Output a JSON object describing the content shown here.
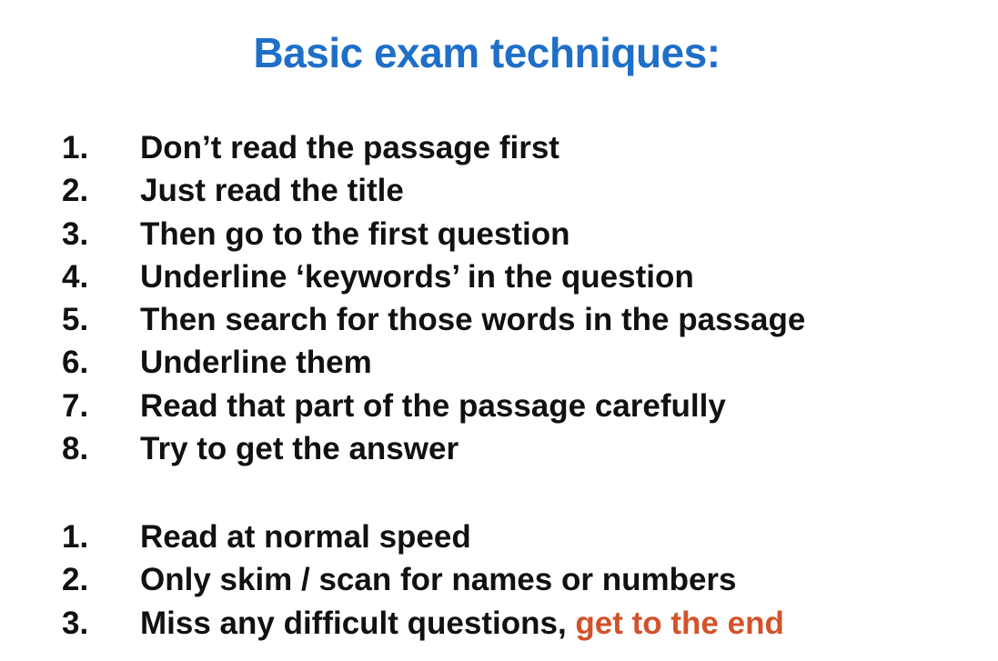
{
  "colors": {
    "title": "#1f6fc8",
    "text": "#111111",
    "highlight": "#d2522a",
    "background": "#ffffff"
  },
  "title": "Basic exam techniques:",
  "list_1": [
    {
      "number": "1.",
      "text": "Don’t read the passage first"
    },
    {
      "number": "2.",
      "text": "Just read the title"
    },
    {
      "number": "3.",
      "text": "Then go to the first question"
    },
    {
      "number": "4.",
      "text": "Underline ‘keywords’ in the question"
    },
    {
      "number": "5.",
      "text": "Then search for those words in the passage"
    },
    {
      "number": "6.",
      "text": "Underline them"
    },
    {
      "number": "7.",
      "text": "Read that part of the passage carefully"
    },
    {
      "number": "8.",
      "text": "Try to get the answer"
    }
  ],
  "list_2": [
    {
      "number": "1.",
      "text": "Read at normal speed"
    },
    {
      "number": "2.",
      "text": "Only skim / scan for names or numbers"
    },
    {
      "number": "3.",
      "text": "Miss any difficult questions, ",
      "highlight": "get to the end"
    }
  ]
}
